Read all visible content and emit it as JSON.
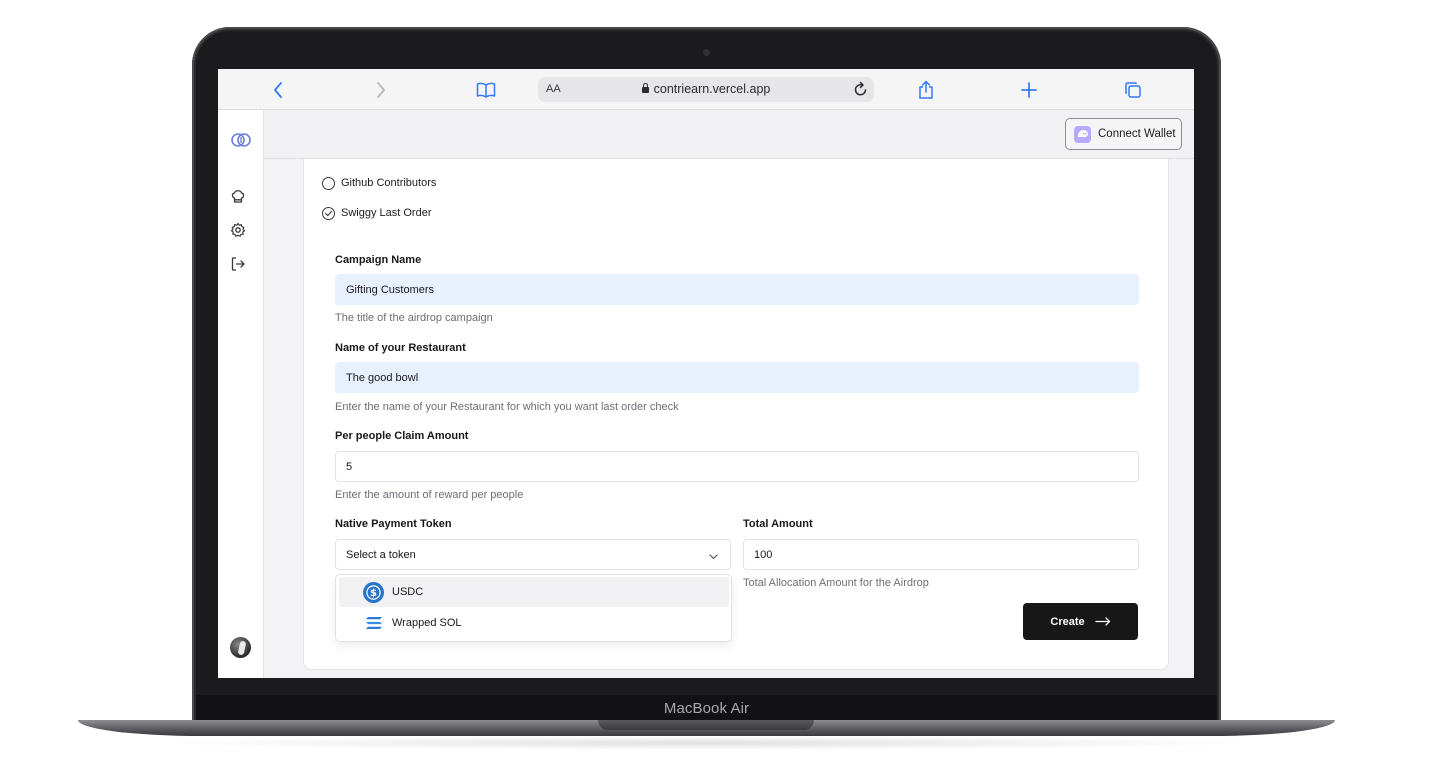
{
  "device": {
    "label": "MacBook Air"
  },
  "browser": {
    "text_size_label": "AA",
    "url": "contriearn.vercel.app"
  },
  "header": {
    "connect_wallet_label": "Connect Wallet"
  },
  "sidebar": {
    "items": [
      {
        "name": "logo",
        "icon": "link-logo-icon"
      },
      {
        "name": "home",
        "icon": "chef-hat-icon"
      },
      {
        "name": "settings",
        "icon": "gear-icon"
      },
      {
        "name": "logout",
        "icon": "logout-icon"
      }
    ]
  },
  "form": {
    "options": [
      {
        "label": "Github Contributors",
        "selected": false
      },
      {
        "label": "Swiggy Last Order",
        "selected": true
      }
    ],
    "campaign_name": {
      "label": "Campaign Name",
      "value": "Gifting Customers",
      "hint": "The title of the airdrop campaign"
    },
    "restaurant_name": {
      "label": "Name of your Restaurant",
      "value": "The good bowl",
      "hint": "Enter the name of your Restaurant for which you want last order check"
    },
    "claim_amount": {
      "label": "Per people Claim Amount",
      "value": "5",
      "hint": "Enter the amount of reward per people"
    },
    "payment_token": {
      "label": "Native Payment Token",
      "placeholder": "Select a token",
      "options": [
        {
          "label": "USDC",
          "icon": "usdc-icon",
          "highlighted": true
        },
        {
          "label": "Wrapped SOL",
          "icon": "solana-icon",
          "highlighted": false
        }
      ]
    },
    "total_amount": {
      "label": "Total Amount",
      "value": "100",
      "hint": "Total Allocation Amount for the Airdrop"
    },
    "create_label": "Create"
  },
  "colors": {
    "accent_dark": "#171717",
    "autofill_blue": "#e8f0fe",
    "usdc_blue": "#2775ca",
    "wallet_purple": "#b7a9ff"
  }
}
